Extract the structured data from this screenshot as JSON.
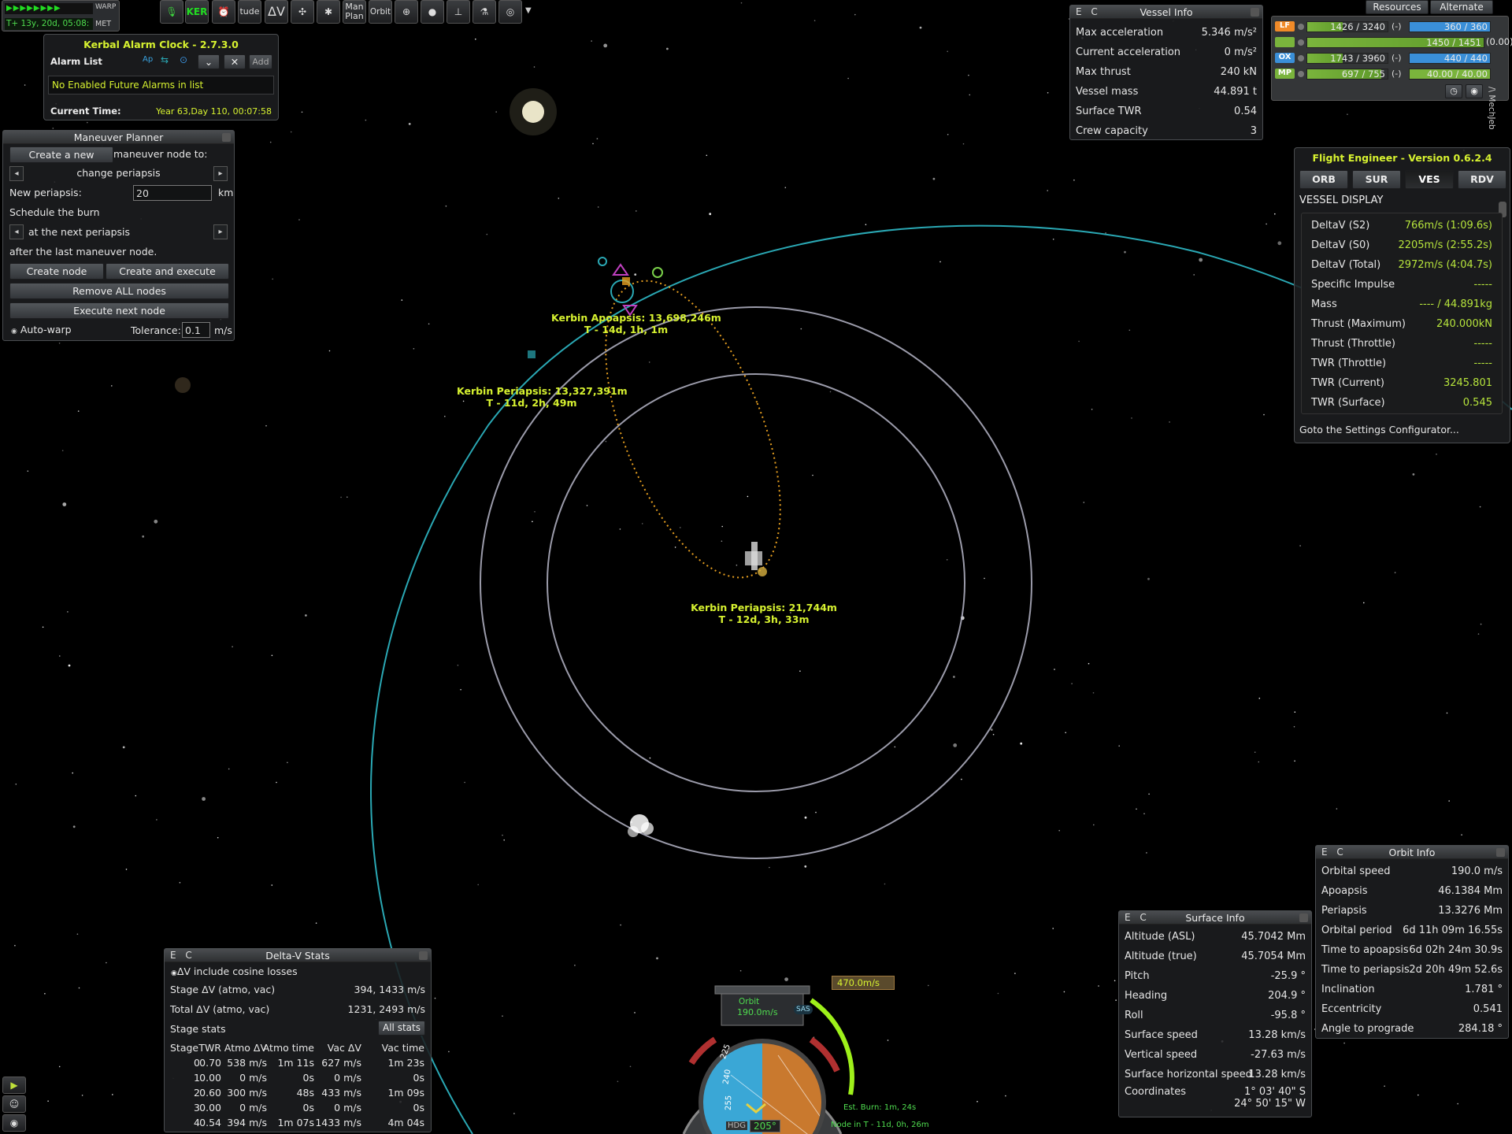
{
  "top_left": {
    "warp_label": "WARP",
    "met_time": "T+ 13y, 20d, 05:08:",
    "met_label": "MET"
  },
  "toolbar": {
    "items": [
      "KER",
      "tude",
      "ΔV",
      "Man Plan",
      "Orbit"
    ]
  },
  "alarm_clock": {
    "title": "Kerbal Alarm Clock - 2.7.3.0",
    "list_label": "Alarm List",
    "ap_label": "Ap",
    "add_label": "Add",
    "message": "No Enabled Future Alarms in list",
    "current_time_label": "Current Time:",
    "current_time_value": "Year 63,Day 110, 00:07:58"
  },
  "maneuver_planner": {
    "title": "Maneuver Planner",
    "create_new": "Create a new",
    "node_to": "maneuver node to:",
    "operation": "change periapsis",
    "new_periapsis_label": "New periapsis:",
    "new_periapsis_value": "20",
    "unit_km": "km",
    "schedule": "Schedule the burn",
    "timing": "at the next periapsis",
    "after": "after the last maneuver node.",
    "create_node": "Create node",
    "create_execute": "Create and execute",
    "remove_all": "Remove ALL nodes",
    "execute_next": "Execute next node",
    "auto_warp": "Auto-warp",
    "tolerance_label": "Tolerance:",
    "tolerance_value": "0.1",
    "tolerance_unit": "m/s"
  },
  "vessel_info": {
    "ec": "E C",
    "title": "Vessel Info",
    "rows": [
      {
        "k": "Max acceleration",
        "v": "5.346 m/s²"
      },
      {
        "k": "Current acceleration",
        "v": "0 m/s²"
      },
      {
        "k": "Max thrust",
        "v": "240 kN"
      },
      {
        "k": "Vessel mass",
        "v": "44.891 t"
      },
      {
        "k": "Surface TWR",
        "v": "0.54"
      },
      {
        "k": "Crew capacity",
        "v": "3"
      }
    ]
  },
  "resources": {
    "tab_resources": "Resources",
    "tab_alternate": "Alternate",
    "rows": [
      {
        "label": "LF",
        "color": "#f08a28",
        "left": "1426 / 3240",
        "right": "360 / 360",
        "fill_left": 0.44,
        "fill_right": 1.0
      },
      {
        "label": "",
        "color": "#7ab43c",
        "left": "1450 / 1451",
        "right": "(0.00)",
        "fill_left": 1.0,
        "fill_right": 0
      },
      {
        "label": "OX",
        "color": "#3a8fd8",
        "left": "1743 / 3960",
        "right": "440 / 440",
        "fill_left": 0.44,
        "fill_right": 1.0
      },
      {
        "label": "MP",
        "color": "#7ab43c",
        "left": "697 / 755",
        "right": "40.00 / 40.00",
        "fill_left": 0.92,
        "fill_right": 1.0
      }
    ],
    "dash": "(-)",
    "mechjeb": "/\\ MechJeb"
  },
  "flight_engineer": {
    "title": "Flight Engineer  -  Version 0.6.2.4",
    "tabs": [
      "ORB",
      "SUR",
      "VES",
      "RDV"
    ],
    "section": "VESSEL DISPLAY",
    "rows": [
      {
        "k": "DeltaV (S2)",
        "v": "766m/s (1:09.6s)"
      },
      {
        "k": "DeltaV (S0)",
        "v": "2205m/s (2:55.2s)"
      },
      {
        "k": "DeltaV (Total)",
        "v": "2972m/s (4:04.7s)"
      },
      {
        "k": "Specific Impulse",
        "v": "-----"
      },
      {
        "k": "Mass",
        "v": "---- / 44.891kg"
      },
      {
        "k": "Thrust (Maximum)",
        "v": "240.000kN"
      },
      {
        "k": "Thrust (Throttle)",
        "v": "-----"
      },
      {
        "k": "TWR (Throttle)",
        "v": "-----"
      },
      {
        "k": "TWR (Current)",
        "v": "3245.801"
      },
      {
        "k": "TWR (Surface)",
        "v": "0.545"
      }
    ],
    "settings": "Goto the Settings Configurator..."
  },
  "map_labels": {
    "apoapsis": "Kerbin Apoapsis: 13,698,246m",
    "apoapsis_t": "T - 14d, 1h, 1m",
    "periapsis1": "Kerbin Periapsis: 13,327,391m",
    "periapsis1_t": "T - 11d, 2h, 49m",
    "periapsis2": "Kerbin Periapsis: 21,744m",
    "periapsis2_t": "T - 12d, 3h, 33m"
  },
  "orbit_info": {
    "ec": "E C",
    "title": "Orbit Info",
    "rows": [
      {
        "k": "Orbital speed",
        "v": "190.0 m/s"
      },
      {
        "k": "Apoapsis",
        "v": "46.1384 Mm"
      },
      {
        "k": "Periapsis",
        "v": "13.3276 Mm"
      },
      {
        "k": "Orbital period",
        "v": "6d 11h 09m 16.55s"
      },
      {
        "k": "Time to apoapsis",
        "v": "6d 02h 24m 30.9s"
      },
      {
        "k": "Time to periapsis",
        "v": "2d 20h 49m 52.6s"
      },
      {
        "k": "Inclination",
        "v": "1.781 °"
      },
      {
        "k": "Eccentricity",
        "v": "0.541"
      },
      {
        "k": "Angle to prograde",
        "v": "284.18 °"
      }
    ]
  },
  "surface_info": {
    "ec": "E C",
    "title": "Surface Info",
    "rows": [
      {
        "k": "Altitude (ASL)",
        "v": "45.7042 Mm"
      },
      {
        "k": "Altitude (true)",
        "v": "45.7054 Mm"
      },
      {
        "k": "Pitch",
        "v": "-25.9 °"
      },
      {
        "k": "Heading",
        "v": "204.9 °"
      },
      {
        "k": "Roll",
        "v": "-95.8 °"
      },
      {
        "k": "Surface speed",
        "v": "13.28 km/s"
      },
      {
        "k": "Vertical speed",
        "v": "-27.63 m/s"
      },
      {
        "k": "Surface horizontal speed",
        "v": "13.28 km/s"
      }
    ],
    "coord_label": "Coordinates",
    "coord_1": "1° 03' 40\" S",
    "coord_2": "24° 50' 15\" W"
  },
  "delta_v": {
    "ec": "E C",
    "title": "Delta-V Stats",
    "cosine": "ΔV include cosine losses",
    "stage_dv_label": "Stage ΔV (atmo, vac)",
    "stage_dv_value": "394, 1433 m/s",
    "total_dv_label": "Total ΔV (atmo, vac)",
    "total_dv_value": "1231, 2493 m/s",
    "stage_stats": "Stage stats",
    "all_stats": "All stats",
    "headers": [
      "Stage",
      "TWR",
      "Atmo ΔV",
      "Atmo time",
      "Vac ΔV",
      "Vac time"
    ],
    "rows": [
      [
        "0",
        "0.70",
        "538 m/s",
        "1m 11s",
        "627 m/s",
        "1m 23s"
      ],
      [
        "1",
        "0.00",
        "0 m/s",
        "0s",
        "0 m/s",
        "0s"
      ],
      [
        "2",
        "0.60",
        "300 m/s",
        "48s",
        "433 m/s",
        "1m 09s"
      ],
      [
        "3",
        "0.00",
        "0 m/s",
        "0s",
        "0 m/s",
        "0s"
      ],
      [
        "4",
        "0.54",
        "394 m/s",
        "1m 07s",
        "1433 m/s",
        "4m 04s"
      ]
    ]
  },
  "navball": {
    "mode": "Orbit",
    "speed": "190.0m/s",
    "sas": "SAS",
    "burn_dv": "470.0m/s",
    "hdg_label": "HDG",
    "hdg_value": "205°",
    "est_burn": "Est. Burn: 1m, 24s",
    "node_in": "Node in T - 11d, 0h, 26m",
    "ticks": [
      "225",
      "240",
      "255"
    ]
  },
  "colors": {
    "accent_yellow": "#d7f230",
    "value_green": "#b7e53c",
    "orbit_cyan": "#2aa8b4",
    "maneuver_orange": "#e8a020"
  }
}
